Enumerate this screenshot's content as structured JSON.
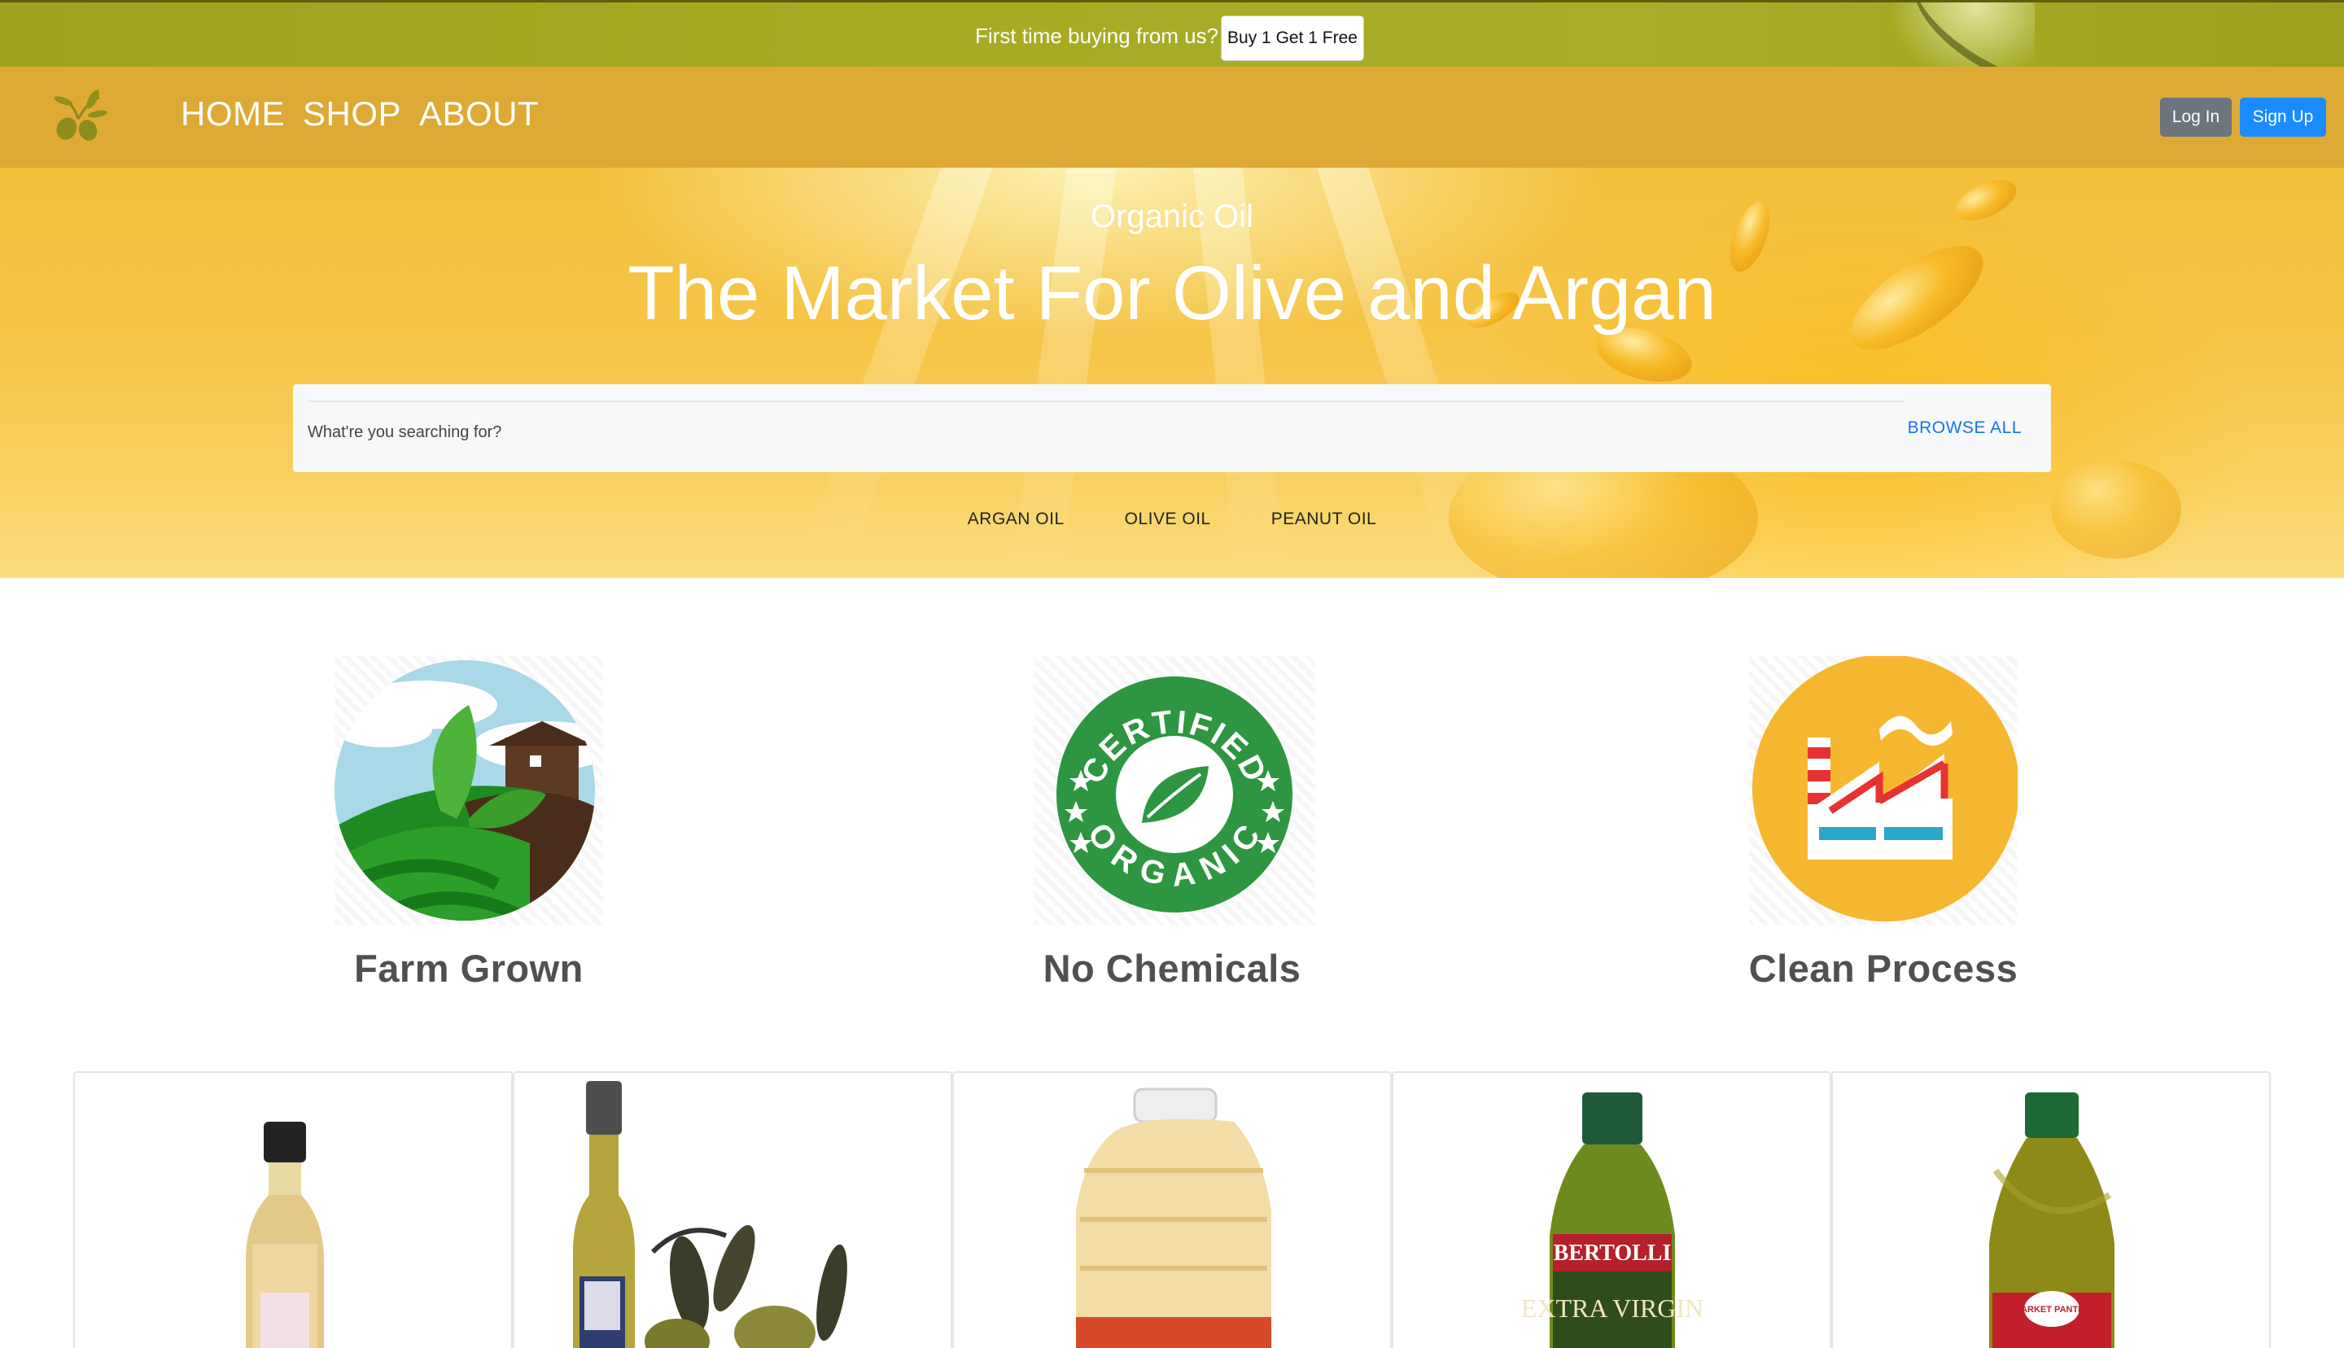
{
  "promo": {
    "text": "First time buying from us?",
    "button_label": "Buy 1 Get 1 Free"
  },
  "nav": {
    "logo_icon": "olive-branch-icon",
    "links": [
      "HOME",
      "SHOP",
      "ABOUT"
    ],
    "login_label": "Log In",
    "signup_label": "Sign Up"
  },
  "hero": {
    "subtitle": "Organic Oil",
    "title": "The Market For Olive and Argan",
    "search_placeholder": "What're you searching for?",
    "browse_all_label": "BROWSE ALL",
    "categories": [
      "ARGAN OIL",
      "OLIVE OIL",
      "PEANUT OIL"
    ]
  },
  "features": [
    {
      "label": "Farm Grown",
      "icon": "farm-icon"
    },
    {
      "label": "No Chemicals",
      "icon": "certified-organic-icon"
    },
    {
      "label": "Clean Process",
      "icon": "factory-icon"
    }
  ],
  "badge": {
    "top_text": "CERTIFIED",
    "bottom_text": "ORGANIC"
  },
  "products": [
    {
      "image": "small-argan-oil-bottle"
    },
    {
      "image": "olive-oil-bottle-with-olives"
    },
    {
      "image": "plastic-vegetable-oil-jug"
    },
    {
      "image": "bertolli-extra-virgin-olive-oil",
      "brand": "BERTOLLI",
      "label": "EXTRA VIRGIN"
    },
    {
      "image": "market-pantry-olive-oil",
      "brand": "MARKET PANTRY"
    }
  ],
  "colors": {
    "promo_bg": "#a8aa24",
    "navbar_bg": "#deaa35",
    "login_bg": "#6c757d",
    "signup_bg": "#1a8cff",
    "browse_all": "#1a73e8",
    "feature_text": "#505050"
  }
}
